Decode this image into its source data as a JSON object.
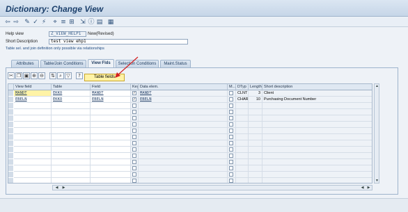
{
  "window": {
    "title": "Dictionary: Change View"
  },
  "toolbar": {
    "icons": [
      "back-icon",
      "forward-icon",
      "display-change-icon",
      "check-icon",
      "activate-icon",
      "where-used-icon",
      "object-list-icon",
      "hierarchy-icon",
      "navigate-icon",
      "info-icon",
      "display-icon",
      "maintenance-icon"
    ]
  },
  "form": {
    "help_view_label": "Help view",
    "help_view_value": "Z_VIEW_HELP1",
    "status": "New(Revised)",
    "short_desc_label": "Short Description",
    "short_desc_value": "test view ehp1",
    "note": "Table sel. and join definition only possible via relationships"
  },
  "tabs": [
    {
      "label": "Attributes",
      "active": false
    },
    {
      "label": "Table/Join Conditions",
      "active": false
    },
    {
      "label": "View Flds",
      "active": true
    },
    {
      "label": "Selection Conditions",
      "active": false
    },
    {
      "label": "Maint.Status",
      "active": false
    }
  ],
  "panel_toolbar": {
    "icons": [
      "cut-icon",
      "copy-icon",
      "paste-icon",
      "insert-row-icon",
      "delete-row-icon",
      "sort-icon",
      "find-icon",
      "filter-icon",
      "help-icon"
    ],
    "table_fields_button": "Table fields"
  },
  "grid": {
    "columns": [
      "View field",
      "Table",
      "Field",
      "Key",
      "Data elem.",
      "M...",
      "DTyp",
      "Length",
      "Short description"
    ],
    "rows": [
      {
        "view_field": "MANDT",
        "table": "EKKO",
        "field": "MANDT",
        "key": true,
        "data_elem": "MANDT",
        "m": false,
        "dtyp": "CLNT",
        "length": "3",
        "desc": "Client"
      },
      {
        "view_field": "EBELN",
        "table": "EKKO",
        "field": "EBELN",
        "key": true,
        "data_elem": "EBELN",
        "m": false,
        "dtyp": "CHAR",
        "length": "10",
        "desc": "Purchasing Document Number"
      }
    ],
    "empty_rows": 13
  },
  "colors": {
    "accent": "#1b3f6b",
    "highlight": "#fff3a6",
    "arrow": "#d42020"
  }
}
